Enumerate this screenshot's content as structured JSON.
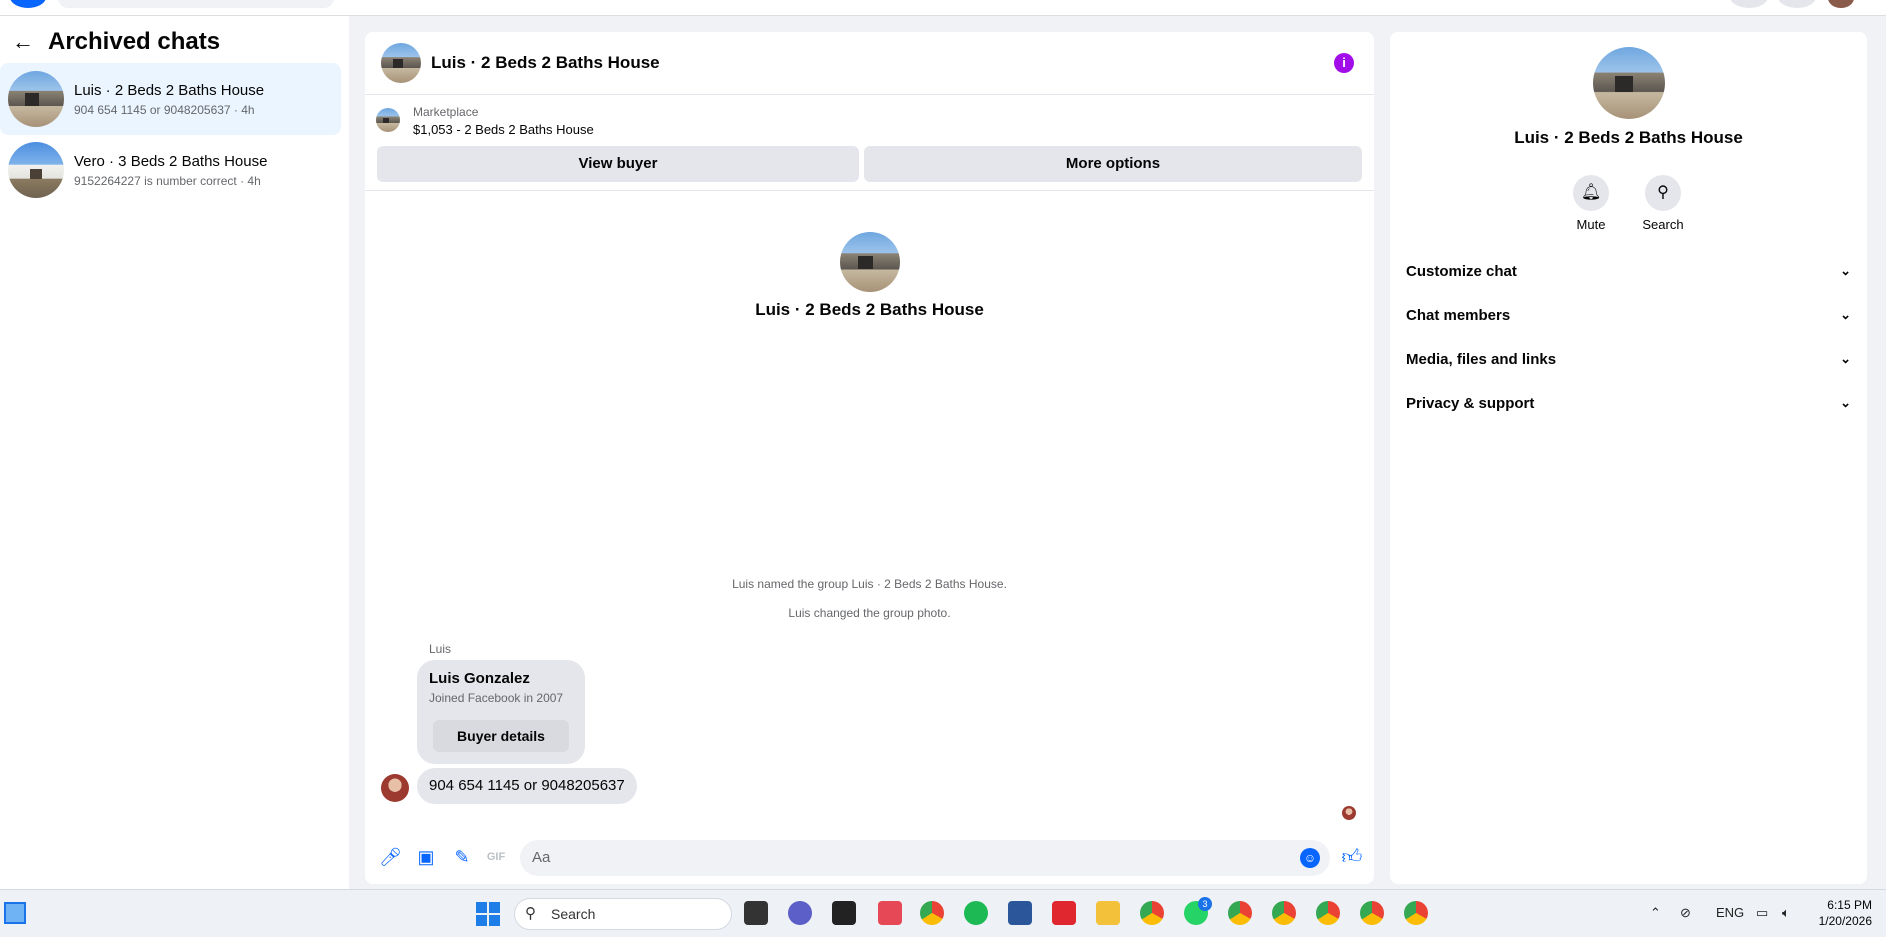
{
  "sidebar": {
    "title": "Archived chats",
    "chats": [
      {
        "name": "Luis · 2 Beds 2 Baths House",
        "preview": "904 654 1145 or 9048205637 · 4h"
      },
      {
        "name": "Vero · 3 Beds 2 Baths House",
        "preview": "9152264227 is number correct · 4h"
      }
    ]
  },
  "chat": {
    "title": "Luis · 2 Beds 2 Baths House",
    "marketplace_label": "Marketplace",
    "listing": "$1,053 - 2 Beds 2 Baths House",
    "view_buyer": "View buyer",
    "more_options": "More options",
    "intro_name": "Luis · 2 Beds 2 Baths House",
    "system_messages": [
      "Luis named the group Luis · 2 Beds 2 Baths House.",
      "Luis changed the group photo."
    ],
    "sender": "Luis",
    "profile_name": "Luis Gonzalez",
    "profile_joined": "Joined Facebook in 2007",
    "buyer_details": "Buyer details",
    "message": "904 654 1145 or 9048205637",
    "composer_placeholder": "Aa"
  },
  "info": {
    "name": "Luis · 2 Beds 2 Baths House",
    "mute": "Mute",
    "search": "Search",
    "sections": [
      "Customize chat",
      "Chat members",
      "Media, files and links",
      "Privacy & support"
    ]
  },
  "taskbar": {
    "search": "Search",
    "lang": "ENG",
    "time": "6:15 PM",
    "date": "1/20/2026",
    "whatsapp_badge": "3"
  },
  "colors": {
    "accent": "#0866ff",
    "info": "#a20eea",
    "active_chat": "#ebf5ff"
  }
}
